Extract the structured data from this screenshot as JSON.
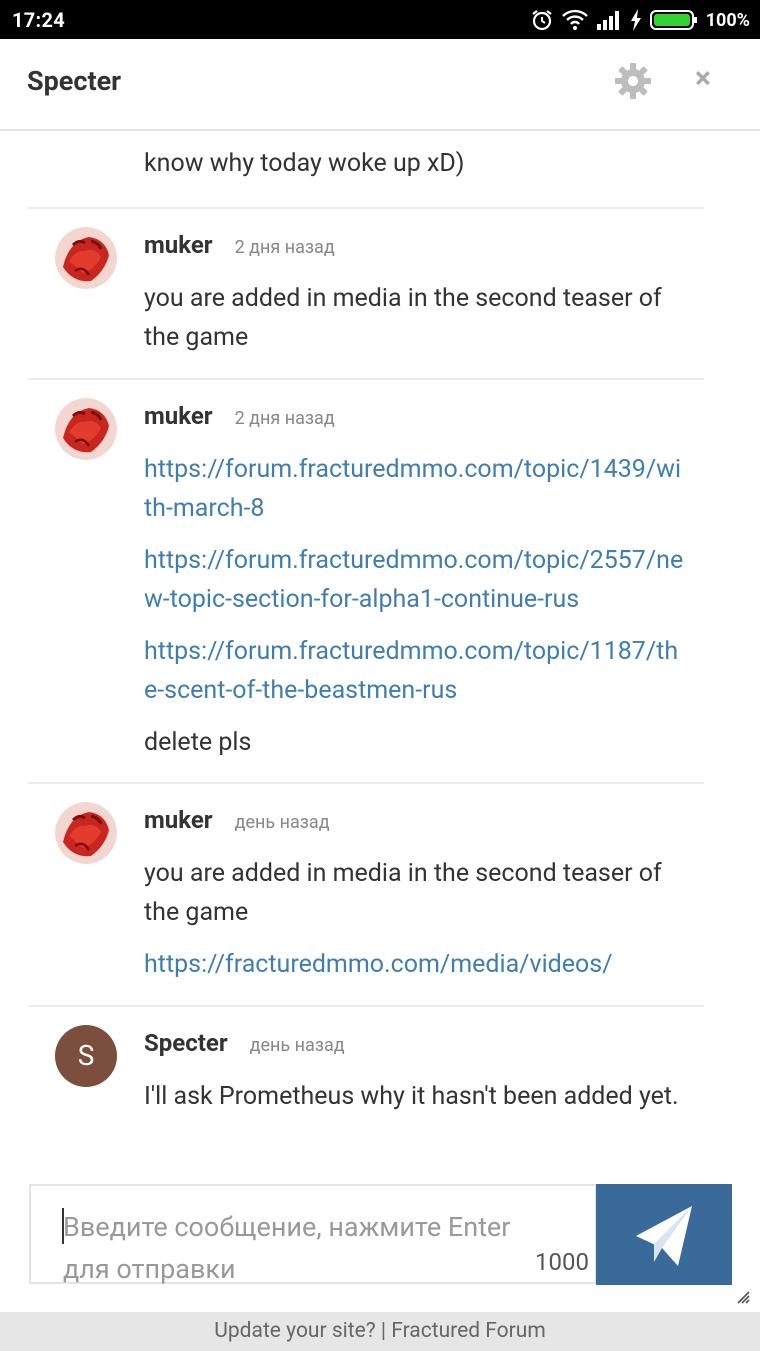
{
  "status_bar": {
    "time": "17:24",
    "battery": "100%",
    "icons": [
      "alarm-icon",
      "wifi-icon",
      "signal-icon",
      "charging-icon",
      "battery-icon"
    ]
  },
  "header": {
    "title": "Specter",
    "settings_icon": "gear-icon",
    "close_icon": "close-icon",
    "close_glyph": "×"
  },
  "messages": {
    "partial_tail": "know why today woke up xD)",
    "items": [
      {
        "author": "muker",
        "time": "2 дня назад",
        "lines": [
          "you are added in media in the second teaser of the game"
        ]
      },
      {
        "author": "muker",
        "time": "2 дня назад",
        "links": [
          "https://forum.fracturedmmo.com/topic/1439/with-march-8",
          "https://forum.fracturedmmo.com/topic/2557/new-topic-section-for-alpha1-continue-rus",
          "https://forum.fracturedmmo.com/topic/1187/the-scent-of-the-beastmen-rus"
        ],
        "tail": "delete pls"
      },
      {
        "author": "muker",
        "time": "день назад",
        "lines": [
          "you are added in media in the second teaser of the game"
        ],
        "link": "https://fracturedmmo.com/media/videos/"
      },
      {
        "author": "Specter",
        "avatar_letter": "S",
        "time": "день назад",
        "lines": [
          "I'll ask Prometheus why it hasn't been added yet."
        ]
      }
    ]
  },
  "composer": {
    "placeholder": "Введите сообщение, нажмите Enter для отправки",
    "char_count": "1000",
    "send_icon": "send-icon"
  },
  "footer": {
    "text": "Update your site? | Fractured Forum"
  },
  "colors": {
    "link": "#3f7eaf",
    "send_button": "#3a6a99",
    "avatar_s": "#7b4e3e"
  }
}
